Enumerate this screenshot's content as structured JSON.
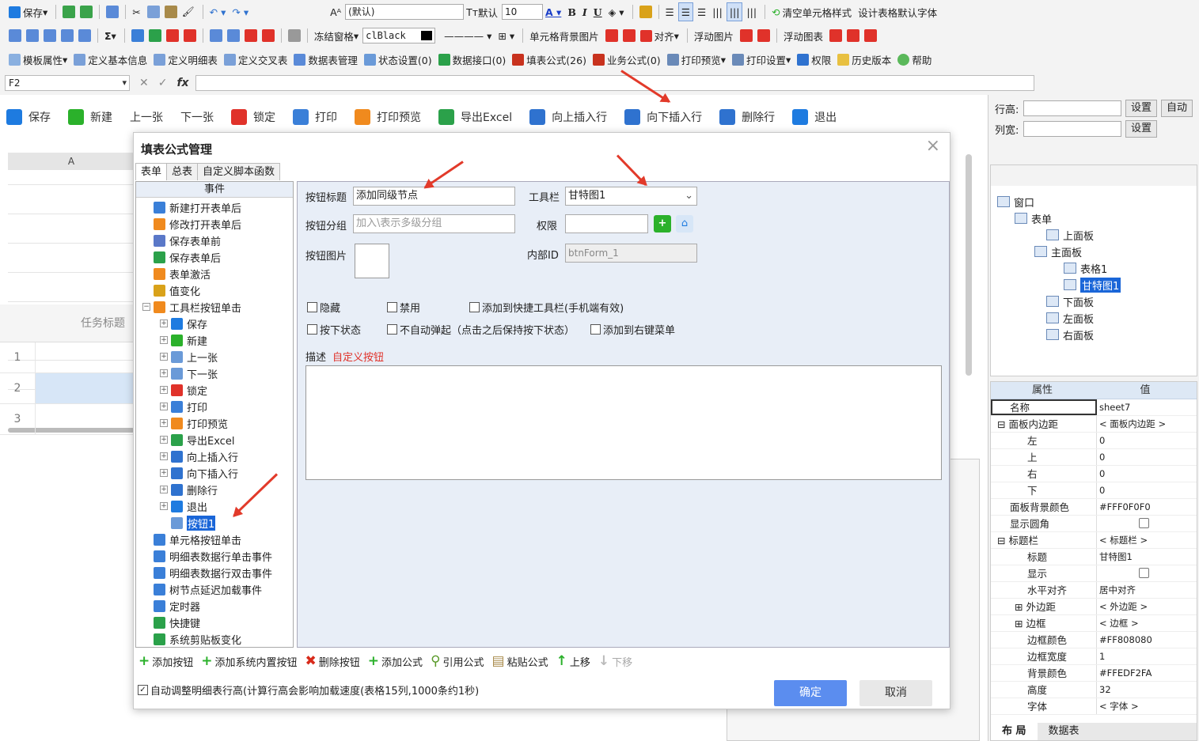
{
  "toolbar1": {
    "save": "保存",
    "font_name": "(默认)",
    "default_label": "默认",
    "font_size": "10",
    "bold": "B",
    "italic": "I",
    "underline": "U",
    "clear_style": "清空单元格样式",
    "default_font": "设计表格默认字体"
  },
  "toolbar2": {
    "sum": "Σ",
    "freeze": "冻结窗格",
    "color_name": "clBlack",
    "cell_bg": "单元格背景图片",
    "align": "对齐",
    "float_img": "浮动图片",
    "float_chart": "浮动图表"
  },
  "toolbar3": {
    "template_props": "模板属性",
    "basic_info": "定义基本信息",
    "detail_table": "定义明细表",
    "cross_table": "定义交叉表",
    "data_table_mgmt": "数据表管理",
    "state_settings": "状态设置(0)",
    "data_interface": "数据接口(0)",
    "fill_formula": "填表公式(26)",
    "biz_formula": "业务公式(0)",
    "print_preview": "打印预览",
    "print_settings": "打印设置",
    "permission": "权限",
    "history": "历史版本",
    "help": "帮助"
  },
  "formula_bar": {
    "cell_ref": "F2",
    "fx": "fx",
    "value": ""
  },
  "form_toolbar": [
    {
      "label": "保存",
      "color": "#1e7be0"
    },
    {
      "label": "新建",
      "color": "#2bb12b"
    },
    {
      "label": "上一张",
      "color": ""
    },
    {
      "label": "下一张",
      "color": ""
    },
    {
      "label": "锁定",
      "color": "#e0322a"
    },
    {
      "label": "打印",
      "color": "#3a7fd8"
    },
    {
      "label": "打印预览",
      "color": "#f08a1e"
    },
    {
      "label": "导出Excel",
      "color": "#2ba14a"
    },
    {
      "label": "向上插入行",
      "color": "#2f72cf"
    },
    {
      "label": "向下插入行",
      "color": "#2f72cf"
    },
    {
      "label": "删除行",
      "color": "#2f72cf"
    },
    {
      "label": "退出",
      "color": "#1e7be0"
    }
  ],
  "sheet": {
    "col_a": "A",
    "task_title": "任务标题",
    "rows": [
      "1",
      "2",
      "3"
    ]
  },
  "right_panel": {
    "row_height": "行高:",
    "col_width": "列宽:",
    "set": "设置",
    "auto": "自动",
    "tree": [
      {
        "label": "窗口",
        "sel": false
      },
      {
        "label": "表单",
        "sel": false
      },
      {
        "label": "上面板",
        "sel": false
      },
      {
        "label": "主面板",
        "sel": false
      },
      {
        "label": "表格1",
        "sel": false
      },
      {
        "label": "甘特图1",
        "sel": true
      },
      {
        "label": "下面板",
        "sel": false
      },
      {
        "label": "左面板",
        "sel": false
      },
      {
        "label": "右面板",
        "sel": false
      }
    ],
    "prop_header": {
      "key": "属性",
      "val": "值"
    },
    "props": [
      {
        "k": "名称",
        "v": "sheet7",
        "t": "sel"
      },
      {
        "k": "面板内边距",
        "v": "< 面板内边距 >",
        "t": "grp"
      },
      {
        "k": "左",
        "v": "0",
        "t": "ind"
      },
      {
        "k": "上",
        "v": "0",
        "t": "ind"
      },
      {
        "k": "右",
        "v": "0",
        "t": "ind"
      },
      {
        "k": "下",
        "v": "0",
        "t": "ind"
      },
      {
        "k": "面板背景颜色",
        "v": "#FFF0F0F0",
        "t": ""
      },
      {
        "k": "显示圆角",
        "v": "",
        "t": "chk"
      },
      {
        "k": "标题栏",
        "v": "< 标题栏 >",
        "t": "grp"
      },
      {
        "k": "标题",
        "v": "甘特图1",
        "t": "ind"
      },
      {
        "k": "显示",
        "v": "",
        "t": "indchk"
      },
      {
        "k": "水平对齐",
        "v": "居中对齐",
        "t": "ind"
      },
      {
        "k": "外边距",
        "v": "< 外边距 >",
        "t": "indgrp"
      },
      {
        "k": "边框",
        "v": "< 边框 >",
        "t": "indgrp"
      },
      {
        "k": "边框颜色",
        "v": "#FF808080",
        "t": "ind"
      },
      {
        "k": "边框宽度",
        "v": "1",
        "t": "ind"
      },
      {
        "k": "背景颜色",
        "v": "#FFEDF2FA",
        "t": "ind"
      },
      {
        "k": "高度",
        "v": "32",
        "t": "ind"
      },
      {
        "k": "字体",
        "v": "< 字体 >",
        "t": "ind"
      }
    ],
    "tab_layout": "布 局",
    "tab_data": "数据表"
  },
  "dialog": {
    "title": "填表公式管理",
    "tabs": [
      "表单",
      "总表",
      "自定义脚本函数"
    ],
    "events_header": "事件",
    "events": [
      {
        "label": "新建打开表单后",
        "lvl": 0,
        "pm": "",
        "color": "#3a7fd8",
        "sel": false
      },
      {
        "label": "修改打开表单后",
        "lvl": 0,
        "pm": "",
        "color": "#f08a1e",
        "sel": false
      },
      {
        "label": "保存表单前",
        "lvl": 0,
        "pm": "",
        "color": "#5a78c8",
        "sel": false
      },
      {
        "label": "保存表单后",
        "lvl": 0,
        "pm": "",
        "color": "#2ba14a",
        "sel": false
      },
      {
        "label": "表单激活",
        "lvl": 0,
        "pm": "",
        "color": "#f08a1e",
        "sel": false
      },
      {
        "label": "值变化",
        "lvl": 0,
        "pm": "",
        "color": "#d9a21a",
        "sel": false
      },
      {
        "label": "工具栏按钮单击",
        "lvl": 0,
        "pm": "⊟",
        "color": "#f08a1e",
        "sel": false
      },
      {
        "label": "保存",
        "lvl": 1,
        "pm": "⊞",
        "color": "#1e7be0",
        "sel": false
      },
      {
        "label": "新建",
        "lvl": 1,
        "pm": "⊞",
        "color": "#2bb12b",
        "sel": false
      },
      {
        "label": "上一张",
        "lvl": 1,
        "pm": "⊞",
        "color": "#6a9ad8",
        "sel": false
      },
      {
        "label": "下一张",
        "lvl": 1,
        "pm": "⊞",
        "color": "#6a9ad8",
        "sel": false
      },
      {
        "label": "锁定",
        "lvl": 1,
        "pm": "⊞",
        "color": "#e0322a",
        "sel": false
      },
      {
        "label": "打印",
        "lvl": 1,
        "pm": "⊞",
        "color": "#3a7fd8",
        "sel": false
      },
      {
        "label": "打印预览",
        "lvl": 1,
        "pm": "⊞",
        "color": "#f08a1e",
        "sel": false
      },
      {
        "label": "导出Excel",
        "lvl": 1,
        "pm": "⊞",
        "color": "#2ba14a",
        "sel": false
      },
      {
        "label": "向上插入行",
        "lvl": 1,
        "pm": "⊞",
        "color": "#2f72cf",
        "sel": false
      },
      {
        "label": "向下插入行",
        "lvl": 1,
        "pm": "⊞",
        "color": "#2f72cf",
        "sel": false
      },
      {
        "label": "删除行",
        "lvl": 1,
        "pm": "⊞",
        "color": "#2f72cf",
        "sel": false
      },
      {
        "label": "退出",
        "lvl": 1,
        "pm": "⊞",
        "color": "#1e7be0",
        "sel": false
      },
      {
        "label": "按钮1",
        "lvl": 1,
        "pm": "",
        "color": "#6a9ad8",
        "sel": true
      },
      {
        "label": "单元格按钮单击",
        "lvl": 0,
        "pm": "",
        "color": "#3a7fd8",
        "sel": false
      },
      {
        "label": "明细表数据行单击事件",
        "lvl": 0,
        "pm": "",
        "color": "#3a7fd8",
        "sel": false
      },
      {
        "label": "明细表数据行双击事件",
        "lvl": 0,
        "pm": "",
        "color": "#3a7fd8",
        "sel": false
      },
      {
        "label": "树节点延迟加载事件",
        "lvl": 0,
        "pm": "",
        "color": "#3a7fd8",
        "sel": false
      },
      {
        "label": "定时器",
        "lvl": 0,
        "pm": "",
        "color": "#3a7fd8",
        "sel": false
      },
      {
        "label": "快捷键",
        "lvl": 0,
        "pm": "",
        "color": "#2ba14a",
        "sel": false
      },
      {
        "label": "系统剪贴板变化",
        "lvl": 0,
        "pm": "",
        "color": "#2ba14a",
        "sel": false
      }
    ],
    "form": {
      "btn_title_label": "按钮标题",
      "btn_title_value": "添加同级节点",
      "toolbar_label": "工具栏",
      "toolbar_value": "甘特图1",
      "btn_group_label": "按钮分组",
      "btn_group_placeholder": "加入\\表示多级分组",
      "permission_label": "权限",
      "permission_value": "",
      "btn_image_label": "按钮图片",
      "internal_id_label": "内部ID",
      "internal_id_value": "btnForm_1",
      "hidden": "隐藏",
      "disabled": "禁用",
      "add_quick": "添加到快捷工具栏(手机端有效)",
      "press_state": "按下状态",
      "no_popup": "不自动弹起（点击之后保持按下状态）",
      "add_context": "添加到右键菜单",
      "desc_label": "描述",
      "desc_value": "自定义按钮"
    },
    "bottom_actions": [
      "添加按钮",
      "添加系统内置按钮",
      "删除按钮",
      "添加公式",
      "引用公式",
      "粘贴公式",
      "上移",
      "下移"
    ],
    "auto_adjust": "自动调整明细表行高(计算行高会影响加载速度(表格15列,1000条约1秒)",
    "ok": "确定",
    "cancel": "取消"
  }
}
